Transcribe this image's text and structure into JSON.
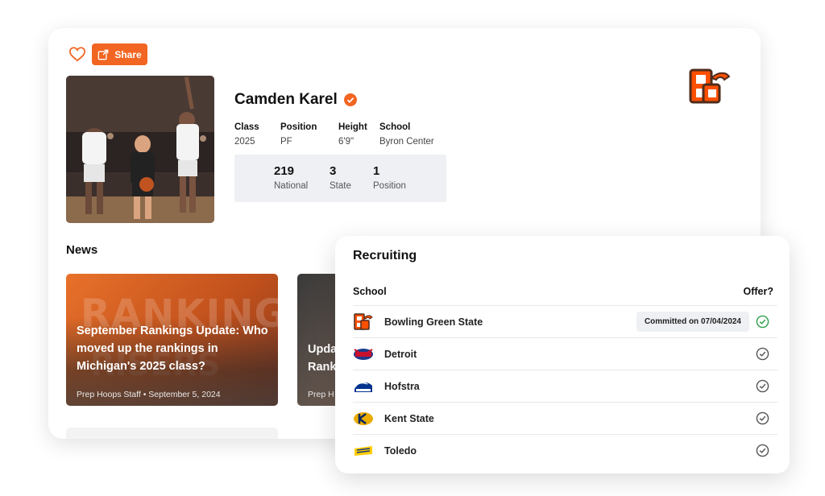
{
  "share_label": "Share",
  "player": {
    "name": "Camden Karel",
    "stats": [
      {
        "label": "Class",
        "value": "2025"
      },
      {
        "label": "Position",
        "value": "PF"
      },
      {
        "label": "Height",
        "value": "6'9\""
      },
      {
        "label": "School",
        "value": "Byron Center"
      }
    ],
    "rankings": [
      {
        "value": "219",
        "label": "National"
      },
      {
        "value": "3",
        "label": "State"
      },
      {
        "value": "1",
        "label": "Position"
      }
    ]
  },
  "news": {
    "title": "News",
    "cards": [
      {
        "headline": "September Rankings Update: Who moved up the rankings in Michigan's 2025 class?",
        "meta": "Prep Hoops Staff • September 5, 2024"
      },
      {
        "headline": "Upda Rank",
        "meta": "Prep H"
      }
    ]
  },
  "recruiting": {
    "title": "Recruiting",
    "col_school": "School",
    "col_offer": "Offer?",
    "rows": [
      {
        "school": "Bowling Green State",
        "status": "Committed on 07/04/2024",
        "icon": "check-circle-green"
      },
      {
        "school": "Detroit",
        "icon": "check-circle-gray"
      },
      {
        "school": "Hofstra",
        "icon": "check-circle-gray"
      },
      {
        "school": "Kent State",
        "icon": "check-circle-gray"
      },
      {
        "school": "Toledo",
        "icon": "check-circle-gray"
      }
    ]
  },
  "colors": {
    "accent": "#f26522",
    "committed_check": "#2ea04b",
    "muted_check": "#555555"
  }
}
